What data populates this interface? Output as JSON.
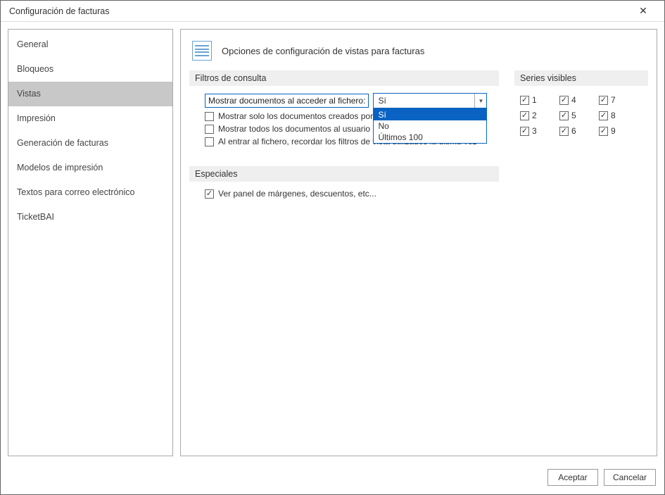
{
  "window": {
    "title": "Configuración de facturas",
    "close_icon": "✕"
  },
  "sidebar": {
    "items": [
      {
        "label": "General",
        "selected": false
      },
      {
        "label": "Bloqueos",
        "selected": false
      },
      {
        "label": "Vistas",
        "selected": true
      },
      {
        "label": "Impresión",
        "selected": false
      },
      {
        "label": "Generación de facturas",
        "selected": false
      },
      {
        "label": "Modelos de impresión",
        "selected": false
      },
      {
        "label": "Textos para correo electrónico",
        "selected": false
      },
      {
        "label": "TicketBAI",
        "selected": false
      }
    ]
  },
  "page": {
    "title": "Opciones de configuración de vistas para facturas"
  },
  "filters": {
    "header": "Filtros de consulta",
    "show_docs_label": "Mostrar documentos al acceder al fichero:",
    "show_docs_value": "Sí",
    "show_docs_options": [
      "Sí",
      "No",
      "Últimos 100"
    ],
    "only_own": {
      "label": "Mostrar solo los documentos creados por",
      "checked": false
    },
    "all_to_user": {
      "label": "Mostrar todos los documentos al usuario",
      "checked": false
    },
    "remember_filters": {
      "label": "Al entrar al fichero, recordar los filtros de vista utilizados la última vez",
      "checked": false
    }
  },
  "series": {
    "header": "Series visibles",
    "items": [
      {
        "label": "1",
        "checked": true
      },
      {
        "label": "2",
        "checked": true
      },
      {
        "label": "3",
        "checked": true
      },
      {
        "label": "4",
        "checked": true
      },
      {
        "label": "5",
        "checked": true
      },
      {
        "label": "6",
        "checked": true
      },
      {
        "label": "7",
        "checked": true
      },
      {
        "label": "8",
        "checked": true
      },
      {
        "label": "9",
        "checked": true
      }
    ]
  },
  "specials": {
    "header": "Especiales",
    "margins_panel": {
      "label": "Ver panel de márgenes, descuentos, etc...",
      "checked": true
    }
  },
  "footer": {
    "accept": "Aceptar",
    "cancel": "Cancelar"
  }
}
